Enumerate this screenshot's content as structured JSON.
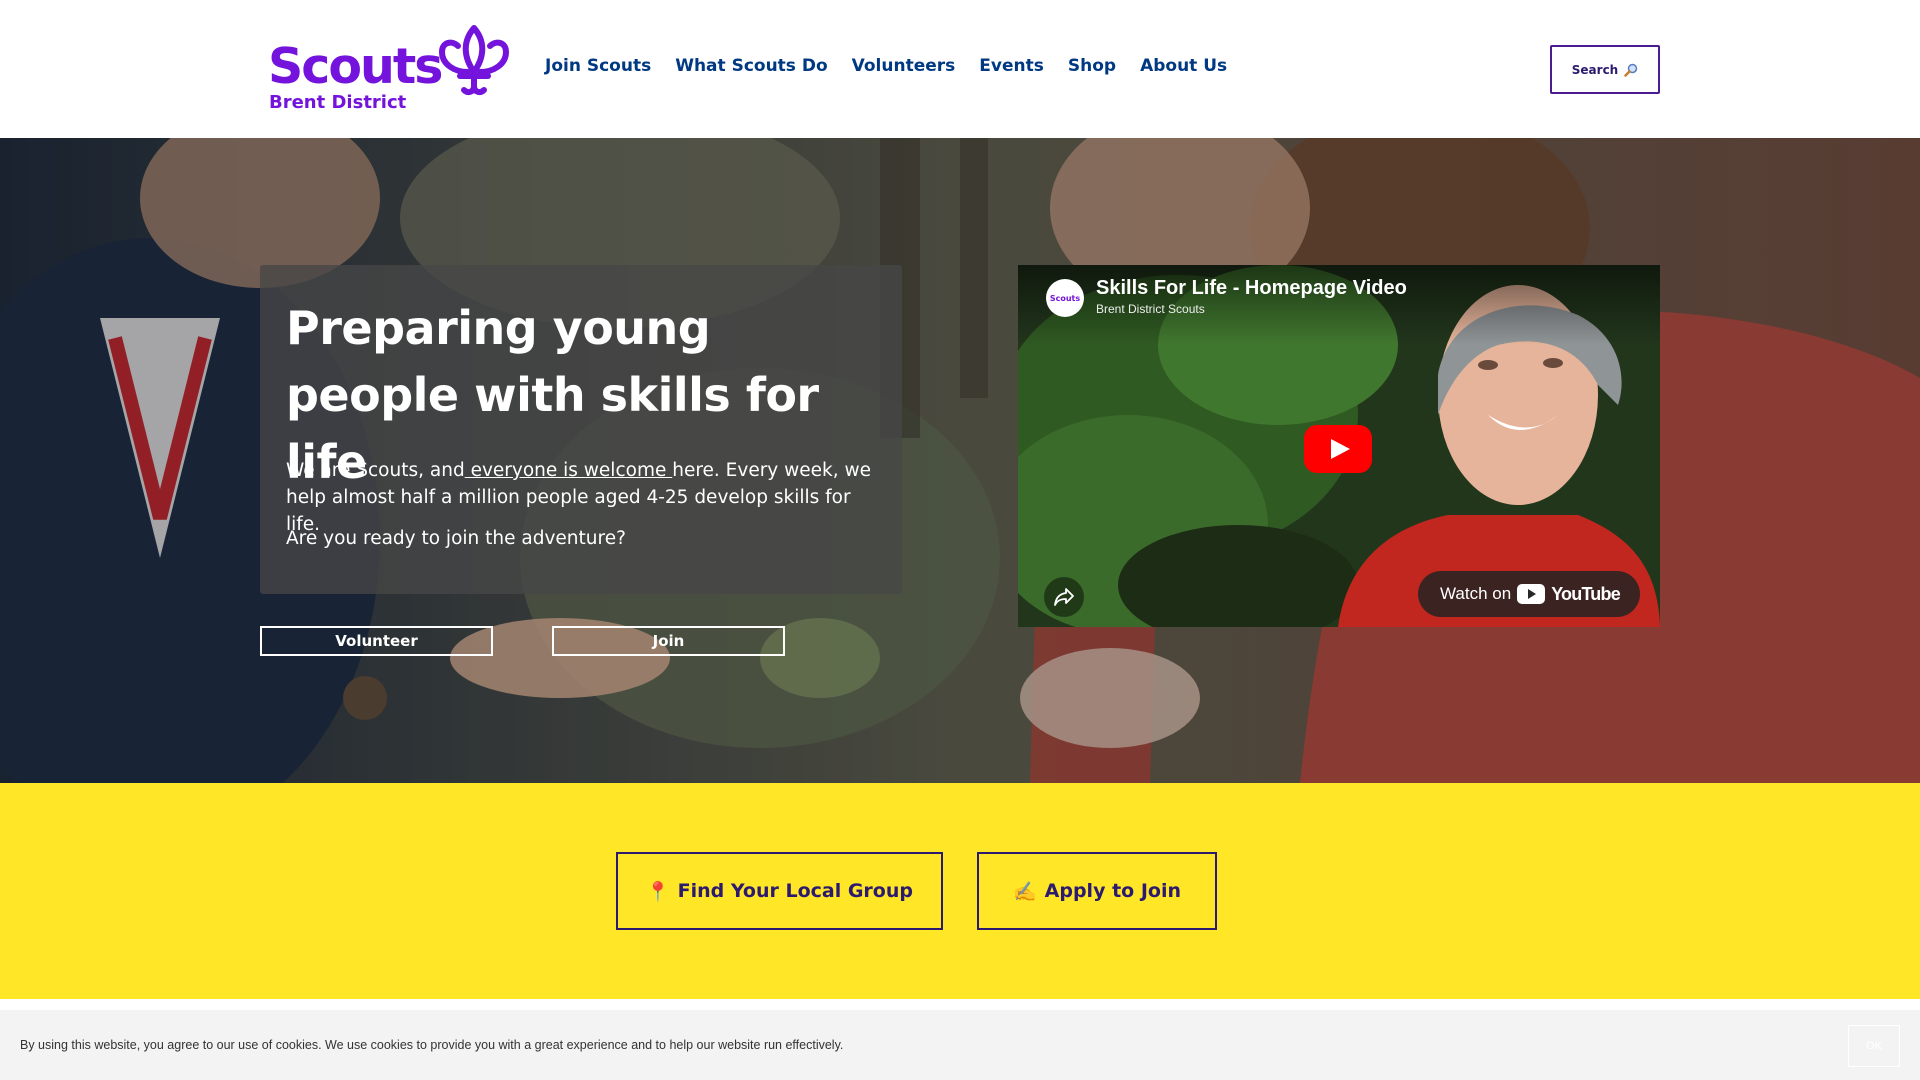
{
  "brand": {
    "name": "Scouts",
    "district": "Brent District",
    "color": "#7413dc"
  },
  "nav": {
    "items": [
      {
        "label": "Join Scouts"
      },
      {
        "label": "What Scouts Do"
      },
      {
        "label": "Volunteers"
      },
      {
        "label": "Events"
      },
      {
        "label": "Shop"
      },
      {
        "label": "About Us"
      }
    ],
    "search_label": "Search",
    "search_icon": "magnifier-icon"
  },
  "hero": {
    "title": "Preparing young people with skills for life",
    "text_before": "We are Scouts, and",
    "text_link": " everyone is welcome ",
    "text_after": "here. Every week, we help almost half a million people aged 4-25 develop skills for life.",
    "question": "Are you ready to join the adventure?",
    "volunteer_label": "Volunteer",
    "join_label": "Join"
  },
  "video": {
    "title": "Skills For Life - Homepage Video",
    "channel": "Brent District Scouts",
    "avatar_text": "Scouts",
    "watch_on_label": "Watch on",
    "platform": "YouTube",
    "play_color": "#ff0000"
  },
  "cta": {
    "find_icon": "📍",
    "find_label": "Find Your Local Group",
    "apply_icon": "✍️",
    "apply_label": "Apply to Join",
    "band_color": "#ffe627"
  },
  "cookie": {
    "text": "By using this website, you agree to our use of cookies. We use cookies to provide you with a great experience and to help our website run effectively.",
    "ok_label": "OK"
  }
}
